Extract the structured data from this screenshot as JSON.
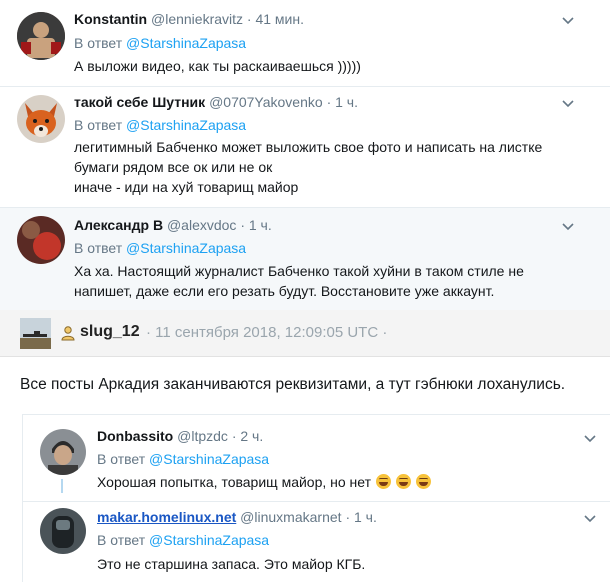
{
  "tweets": [
    {
      "name": "Konstantin",
      "handle": "@lenniekravitz",
      "time": "· 41 мин.",
      "reply_prefix": "В ответ",
      "reply_to": "@StarshinaZapasa",
      "lines": [
        "А выложи видео, как ты раскаиваешься )))))"
      ]
    },
    {
      "name": "такой себе Шутник",
      "handle": "@0707Yakovenko",
      "time": "· 1 ч.",
      "reply_prefix": "В ответ",
      "reply_to": "@StarshinaZapasa",
      "lines": [
        "легитимный Бабченко может выложить свое фото и написать на листке",
        "бумаги рядом все ок или не ок",
        "иначе - иди на хуй товарищ майор"
      ]
    },
    {
      "name": "Александр B",
      "handle": "@alexvdoc",
      "time": "· 1 ч.",
      "reply_prefix": "В ответ",
      "reply_to": "@StarshinaZapasa",
      "lines": [
        "Ха ха. Настоящий журналист Бабченко такой хуйни в таком стиле не",
        "напишет, даже если его резать будут. Восстановите уже аккаунт."
      ]
    }
  ],
  "forum_post": {
    "username": "slug_12",
    "timestamp": "· 11 сентября 2018, 12:09:05 UTC ·",
    "body": "Все посты Аркадия заканчиваются реквизитами, а тут гэбнюки лоханулись."
  },
  "replies": [
    {
      "name": "Donbassito",
      "handle": "@ltpzdc",
      "time": "· 2 ч.",
      "reply_prefix": "В ответ",
      "reply_to": "@StarshinaZapasa",
      "text": "Хорошая попытка, товарищ майор, но нет"
    },
    {
      "name": "makar.homelinux.net",
      "handle": "@linuxmakarnet",
      "time": "· 1 ч.",
      "reply_prefix": "В ответ",
      "reply_to": "@StarshinaZapasa",
      "text": "Это не старшина запаса. Это майор КГБ."
    }
  ],
  "colors": {
    "link": "#1da1f2",
    "muted": "#657786",
    "highlight_bg": "#f5f8fa",
    "thread_line": "#b5d8f0"
  },
  "icons": {
    "more": "chevron-down-icon",
    "user": "user-icon",
    "emoji": "grinning-squinting-face-icon"
  }
}
